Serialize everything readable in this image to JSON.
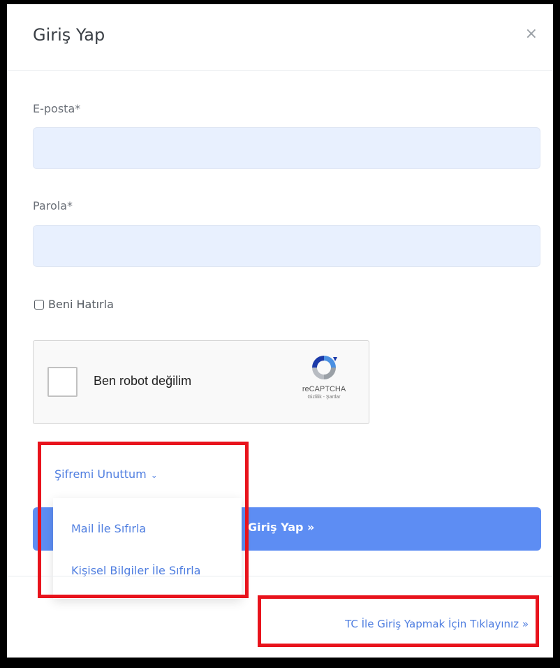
{
  "modal": {
    "title": "Giriş Yap",
    "close_symbol": "×"
  },
  "form": {
    "email_label": "E-posta*",
    "email_value": "",
    "password_label": "Parola*",
    "password_value": "",
    "remember_label": "Beni Hatırla",
    "remember_checked": false
  },
  "captcha": {
    "label": "Ben robot değilim",
    "brand": "reCAPTCHA",
    "links": "Gizlilik - Şartlar",
    "checked": false
  },
  "forgot": {
    "label": "Şifremi Unuttum",
    "chevron": "⌄",
    "options": [
      "Mail İle Sıfırla",
      "Kişisel Bilgiler İle Sıfırla"
    ]
  },
  "submit": {
    "label": "Giriş Yap »"
  },
  "footer": {
    "tc_link": "TC İle Giriş Yapmak İçin Tıklayınız »"
  },
  "colors": {
    "accent": "#5d8df3",
    "link": "#4f7ee0",
    "highlight_box": "#e8131c",
    "input_bg": "#e8f0fe"
  }
}
